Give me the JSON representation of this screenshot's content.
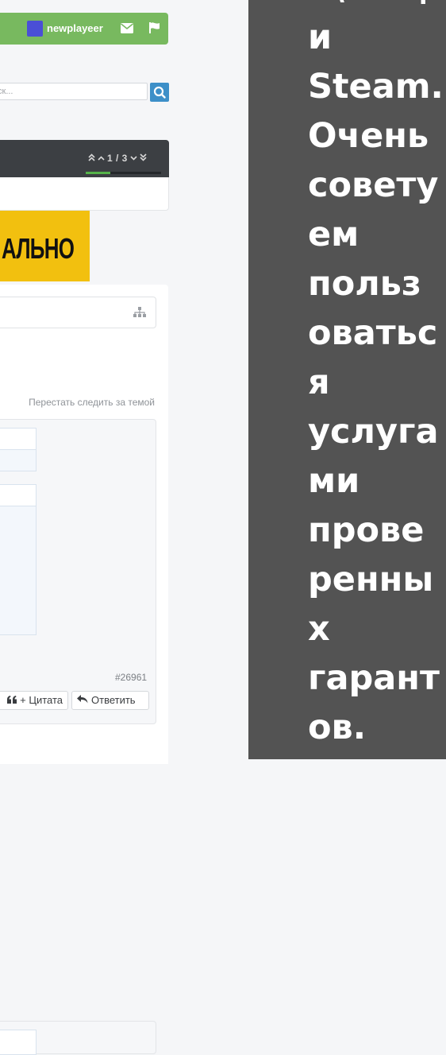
{
  "userbar": {
    "username": "newplayeer",
    "avatar_color": "#4a4fd6",
    "icons": [
      "envelope-icon",
      "flag-icon"
    ]
  },
  "search": {
    "placeholder": "ск...",
    "button_icon": "search-icon"
  },
  "thread_nav": {
    "pager_text": "1 / 3",
    "progress": 0.33,
    "icons": [
      "double-chevron-up-icon",
      "chevron-up-icon",
      "chevron-down-icon",
      "double-chevron-down-icon"
    ]
  },
  "banner": {
    "text": "АЛЬНО",
    "color": "#f2c00f"
  },
  "thread": {
    "unfollow_label": "Перестать следить за темой",
    "post_id": "#26961",
    "quote_label": "+ Цитата",
    "reply_label": "Ответить"
  },
  "overlay": {
    "lines": [
      "и\\вещ",
      "и",
      "Steam.",
      "Очень",
      "совету",
      "ем",
      "польз",
      "оватьс",
      "я",
      "услуга",
      "ми",
      "прове",
      "ренны",
      "х",
      "гарант",
      "ов."
    ]
  },
  "colors": {
    "accent_green": "#78b95f",
    "search_blue": "#3d8fc8",
    "header_dark": "#3c3f43",
    "overlay_gray": "#535353"
  }
}
